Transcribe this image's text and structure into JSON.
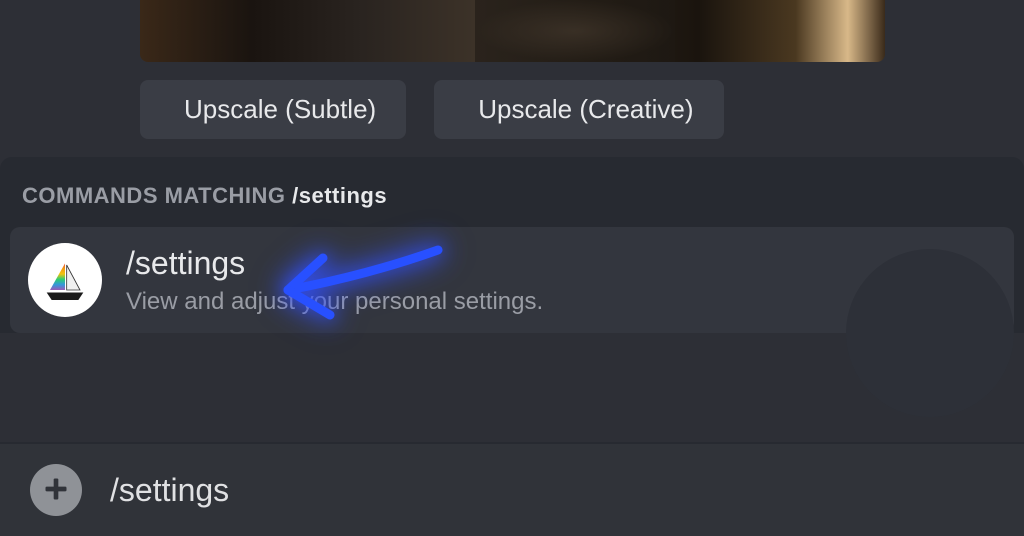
{
  "buttons": {
    "upscale_subtle": "Upscale (Subtle)",
    "upscale_creative": "Upscale (Creative)"
  },
  "autocomplete": {
    "header_prefix": "COMMANDS MATCHING ",
    "header_query": "/settings",
    "command": {
      "name": "/settings",
      "description": "View and adjust your personal settings."
    }
  },
  "input": {
    "value": "/settings"
  },
  "icons": {
    "expand": "expand-icon",
    "plus": "plus-icon",
    "sailboat": "midjourney-logo"
  }
}
